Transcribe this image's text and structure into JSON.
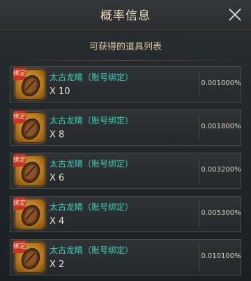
{
  "header": {
    "title": "概率信息"
  },
  "subtitle": "可获得的道具列表",
  "items": [
    {
      "name": "太古龙睛（账号绑定）",
      "quantity": "X 10",
      "probability": "0.001000%",
      "badge": "绑定"
    },
    {
      "name": "太古龙睛（账号绑定）",
      "quantity": "X 8",
      "probability": "0.001800%",
      "badge": "绑定"
    },
    {
      "name": "太古龙睛（账号绑定）",
      "quantity": "X 6",
      "probability": "0.003200%",
      "badge": "绑定"
    },
    {
      "name": "太古龙睛（账号绑定）",
      "quantity": "X 4",
      "probability": "0.005300%",
      "badge": "绑定"
    },
    {
      "name": "太古龙睛（账号绑定）",
      "quantity": "X 2",
      "probability": "0.010100%",
      "badge": "绑定"
    }
  ],
  "icons": {
    "close": "close-icon",
    "item": "dragon-eye-seed-icon"
  },
  "colors": {
    "item_name": "#3ecfb8",
    "title": "#efe3c6",
    "accent_gold": "#e8b84a"
  }
}
